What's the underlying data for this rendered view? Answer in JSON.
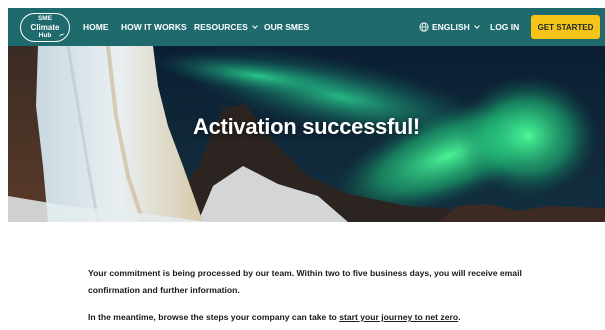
{
  "logo": {
    "line1": "SME",
    "line2": "Climate",
    "line3": "Hub"
  },
  "nav": {
    "home": "HOME",
    "how_it_works": "HOW IT WORKS",
    "resources": "RESOURCES",
    "our_smes": "OUR SMES",
    "language": "ENGLISH",
    "log_in": "LOG IN",
    "get_started": "GET STARTED"
  },
  "hero": {
    "title": "Activation successful!"
  },
  "content": {
    "para1": "Your commitment is being processed by our team. Within two to five business days, you will receive email confirmation and further information.",
    "para2_prefix": "In the meantime, browse the steps your company can take to ",
    "para2_link": "start your journey to net zero",
    "para2_suffix": "."
  },
  "colors": {
    "navbar": "#1f6a6c",
    "cta": "#f6c319",
    "text": "#1a1a1a"
  },
  "icons": [
    "globe-icon",
    "chevron-down-icon"
  ]
}
